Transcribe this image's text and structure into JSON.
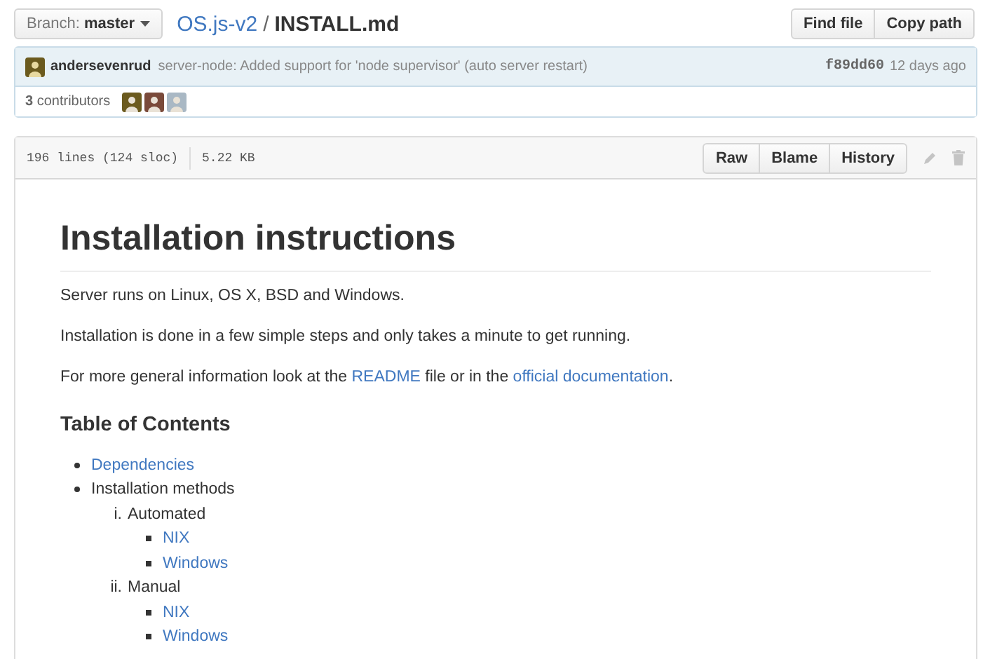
{
  "branch": {
    "label": "Branch:",
    "value": "master"
  },
  "breadcrumb": {
    "repo": "OS.js-v2",
    "separator": "/",
    "file": "INSTALL.md"
  },
  "file_actions": [
    "Find file",
    "Copy path"
  ],
  "commit": {
    "author": "andersevenrud",
    "message": "server-node: Added support for 'node supervisor' (auto server restart)",
    "sha": "f89dd60",
    "time": "12 days ago"
  },
  "contributors": {
    "count": "3",
    "label": "contributors",
    "avatars": [
      {
        "color": "#6b5a1e"
      },
      {
        "color": "#7a4a3a"
      },
      {
        "color": "#a9b8c4"
      }
    ]
  },
  "file": {
    "lines": "196 lines (124 sloc)",
    "size": "5.22 KB",
    "buttons": [
      "Raw",
      "Blame",
      "History"
    ]
  },
  "content": {
    "title": "Installation instructions",
    "paragraphs": [
      [
        {
          "text": "Server runs on Linux, OS X, BSD and Windows."
        }
      ],
      [
        {
          "text": "Installation is done in a few simple steps and only takes a minute to get running."
        }
      ],
      [
        {
          "text": "For more general information look at the "
        },
        {
          "text": "README",
          "link": true
        },
        {
          "text": " file or in the "
        },
        {
          "text": "official documentation",
          "link": true
        },
        {
          "text": "."
        }
      ]
    ],
    "toc_heading": "Table of Contents",
    "toc": [
      {
        "text": "Dependencies",
        "link": true
      },
      {
        "text": "Installation methods",
        "link": false,
        "children": [
          {
            "marker": "i.",
            "text": "Automated",
            "link": false,
            "children": [
              {
                "text": "NIX",
                "link": true
              },
              {
                "text": "Windows",
                "link": true
              }
            ]
          },
          {
            "marker": "ii.",
            "text": "Manual",
            "link": false,
            "children": [
              {
                "text": "NIX",
                "link": true
              },
              {
                "text": "Windows",
                "link": true
              }
            ]
          }
        ]
      }
    ]
  }
}
